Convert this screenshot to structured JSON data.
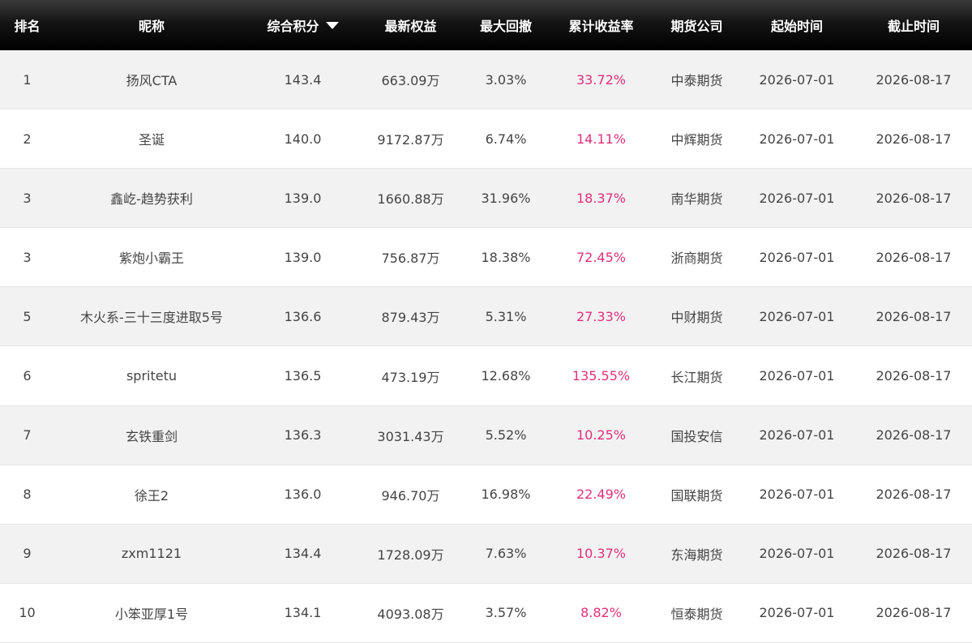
{
  "colors": {
    "accent": "#e0307a",
    "header_bg": "#111111",
    "stripe": "#f2f2f2"
  },
  "header": {
    "rank": "排名",
    "nickname": "昵称",
    "score": "综合积分",
    "equity": "最新权益",
    "drawdown": "最大回撤",
    "return": "累计收益率",
    "broker": "期货公司",
    "start": "起始时间",
    "end": "截止时间",
    "sort_icon": "caret-down-icon"
  },
  "rows": [
    {
      "rank": "1",
      "nickname": "扬风CTA",
      "score": "143.4",
      "equity": "663.09万",
      "drawdown": "3.03%",
      "return": "33.72%",
      "broker": "中泰期货",
      "start": "2026-07-01",
      "end": "2026-08-17"
    },
    {
      "rank": "2",
      "nickname": "圣诞",
      "score": "140.0",
      "equity": "9172.87万",
      "drawdown": "6.74%",
      "return": "14.11%",
      "broker": "中辉期货",
      "start": "2026-07-01",
      "end": "2026-08-17"
    },
    {
      "rank": "3",
      "nickname": "鑫屹-趋势获利",
      "score": "139.0",
      "equity": "1660.88万",
      "drawdown": "31.96%",
      "return": "18.37%",
      "broker": "南华期货",
      "start": "2026-07-01",
      "end": "2026-08-17"
    },
    {
      "rank": "3",
      "nickname": "紫炮小霸王",
      "score": "139.0",
      "equity": "756.87万",
      "drawdown": "18.38%",
      "return": "72.45%",
      "broker": "浙商期货",
      "start": "2026-07-01",
      "end": "2026-08-17"
    },
    {
      "rank": "5",
      "nickname": "木火系-三十三度进取5号",
      "score": "136.6",
      "equity": "879.43万",
      "drawdown": "5.31%",
      "return": "27.33%",
      "broker": "中财期货",
      "start": "2026-07-01",
      "end": "2026-08-17"
    },
    {
      "rank": "6",
      "nickname": "spritetu",
      "score": "136.5",
      "equity": "473.19万",
      "drawdown": "12.68%",
      "return": "135.55%",
      "broker": "长江期货",
      "start": "2026-07-01",
      "end": "2026-08-17"
    },
    {
      "rank": "7",
      "nickname": "玄铁重剑",
      "score": "136.3",
      "equity": "3031.43万",
      "drawdown": "5.52%",
      "return": "10.25%",
      "broker": "国投安信",
      "start": "2026-07-01",
      "end": "2026-08-17"
    },
    {
      "rank": "8",
      "nickname": "徐王2",
      "score": "136.0",
      "equity": "946.70万",
      "drawdown": "16.98%",
      "return": "22.49%",
      "broker": "国联期货",
      "start": "2026-07-01",
      "end": "2026-08-17"
    },
    {
      "rank": "9",
      "nickname": "zxm1121",
      "score": "134.4",
      "equity": "1728.09万",
      "drawdown": "7.63%",
      "return": "10.37%",
      "broker": "东海期货",
      "start": "2026-07-01",
      "end": "2026-08-17"
    },
    {
      "rank": "10",
      "nickname": "小笨亚厚1号",
      "score": "134.1",
      "equity": "4093.08万",
      "drawdown": "3.57%",
      "return": "8.82%",
      "broker": "恒泰期货",
      "start": "2026-07-01",
      "end": "2026-08-17"
    }
  ]
}
